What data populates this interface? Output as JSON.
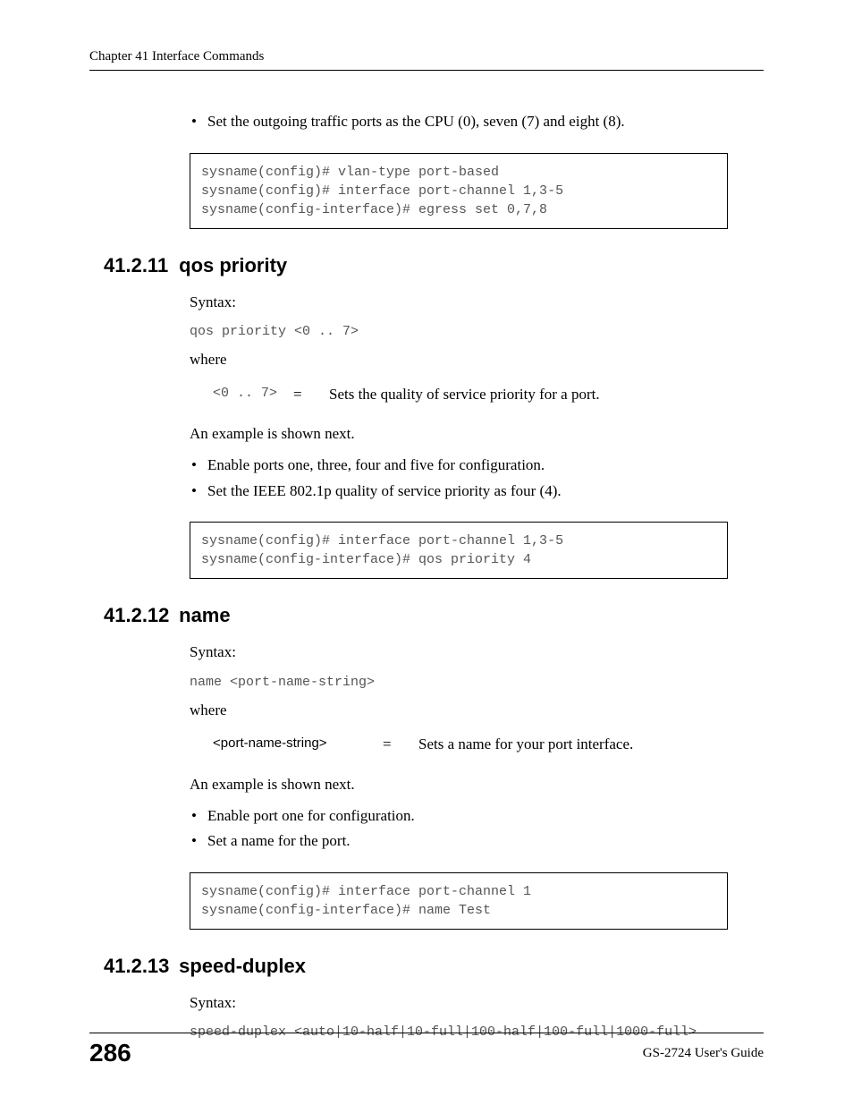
{
  "header": {
    "chapter": "Chapter 41 Interface Commands"
  },
  "intro": {
    "bullet1": "Set the outgoing traffic ports as the CPU (0), seven (7) and eight (8)."
  },
  "codebox1": "sysname(config)# vlan-type port-based\nsysname(config)# interface port-channel 1,3-5\nsysname(config-interface)# egress set 0,7,8",
  "section1": {
    "number": "41.2.11",
    "title": "qos priority",
    "syntax_label": "Syntax:",
    "syntax_code": "qos priority <0 .. 7>",
    "where_label": "where",
    "param_name": "<0 .. 7>",
    "param_eq": "=",
    "param_desc": "Sets the quality of service priority for a port.",
    "example_label": "An example is shown next.",
    "bullet1": "Enable ports one, three, four and five for configuration.",
    "bullet2": "Set the IEEE 802.1p quality of service priority as four (4).",
    "codebox": "sysname(config)# interface port-channel 1,3-5\nsysname(config-interface)# qos priority 4"
  },
  "section2": {
    "number": "41.2.12",
    "title": "name",
    "syntax_label": "Syntax:",
    "syntax_code": "name <port-name-string>",
    "where_label": "where",
    "param_name": "<port-name-string>",
    "param_eq": "=",
    "param_desc": "Sets a name for your port interface.",
    "example_label": "An example is shown next.",
    "bullet1": "Enable port one for configuration.",
    "bullet2": "Set a name for the port.",
    "codebox": "sysname(config)# interface port-channel 1\nsysname(config-interface)# name Test"
  },
  "section3": {
    "number": "41.2.13",
    "title": "speed-duplex",
    "syntax_label": "Syntax:",
    "syntax_code": "speed-duplex <auto|10-half|10-full|100-half|100-full|1000-full>"
  },
  "footer": {
    "page_number": "286",
    "guide": "GS-2724 User's Guide"
  }
}
